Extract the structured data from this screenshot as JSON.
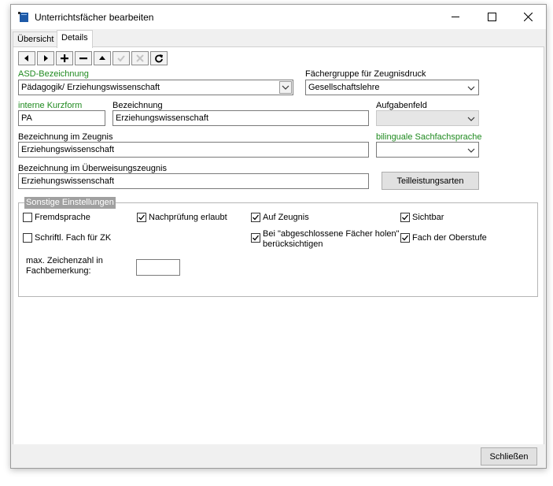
{
  "window": {
    "title": "Unterrichtsfächer bearbeiten"
  },
  "tabs": [
    {
      "label": "Übersicht",
      "active": false
    },
    {
      "label": "Details",
      "active": true
    }
  ],
  "toolbar": {
    "buttons": [
      "first-icon",
      "next-icon",
      "add-icon",
      "remove-icon",
      "up-icon",
      "confirm-icon",
      "cancel-icon",
      "refresh-icon"
    ]
  },
  "form": {
    "asd": {
      "label": "ASD-Bezeichnung",
      "value": "Pädagogik/ Erziehungswissenschaft"
    },
    "faechergruppe": {
      "label": "Fächergruppe für Zeugnisdruck",
      "value": "Gesellschaftslehre"
    },
    "kurzform": {
      "label": "interne Kurzform",
      "value": "PA"
    },
    "bezeichnung": {
      "label": "Bezeichnung",
      "value": "Erziehungswissenschaft"
    },
    "aufgabenfeld": {
      "label": "Aufgabenfeld",
      "value": ""
    },
    "bez_zeugnis": {
      "label": "Bezeichnung im Zeugnis",
      "value": "Erziehungswissenschaft"
    },
    "bilingual": {
      "label": "bilinguale Sachfachsprache",
      "value": ""
    },
    "bez_ueberweisung": {
      "label": "Bezeichnung im Überweisungszeugnis",
      "value": "Erziehungswissenschaft"
    },
    "teilleistung_button": "Teilleistungsarten"
  },
  "settings": {
    "title": "Sonstige Einstellungen",
    "fremdsprache": {
      "label": "Fremdsprache",
      "checked": false
    },
    "nachpruefung": {
      "label": "Nachprüfung erlaubt",
      "checked": true
    },
    "auf_zeugnis": {
      "label": "Auf Zeugnis",
      "checked": true
    },
    "sichtbar": {
      "label": "Sichtbar",
      "checked": true
    },
    "schriftl": {
      "label": "Schriftl. Fach für ZK",
      "checked": false
    },
    "abgeschlossen": {
      "label_line1": "Bei \"abgeschlossene Fächer holen\"",
      "label_line2": "berücksichtigen",
      "checked": true
    },
    "oberstufe": {
      "label": "Fach der Oberstufe",
      "checked": true
    },
    "max_zeichen": {
      "label_line1": "max. Zeichenzahl in",
      "label_line2": "Fachbemerkung:",
      "value": ""
    }
  },
  "footer": {
    "close_button": "Schließen"
  },
  "colors": {
    "accent_green": "#1f8a1f",
    "title_bg": "#ffffff",
    "window_bg": "#f0f0f0"
  }
}
